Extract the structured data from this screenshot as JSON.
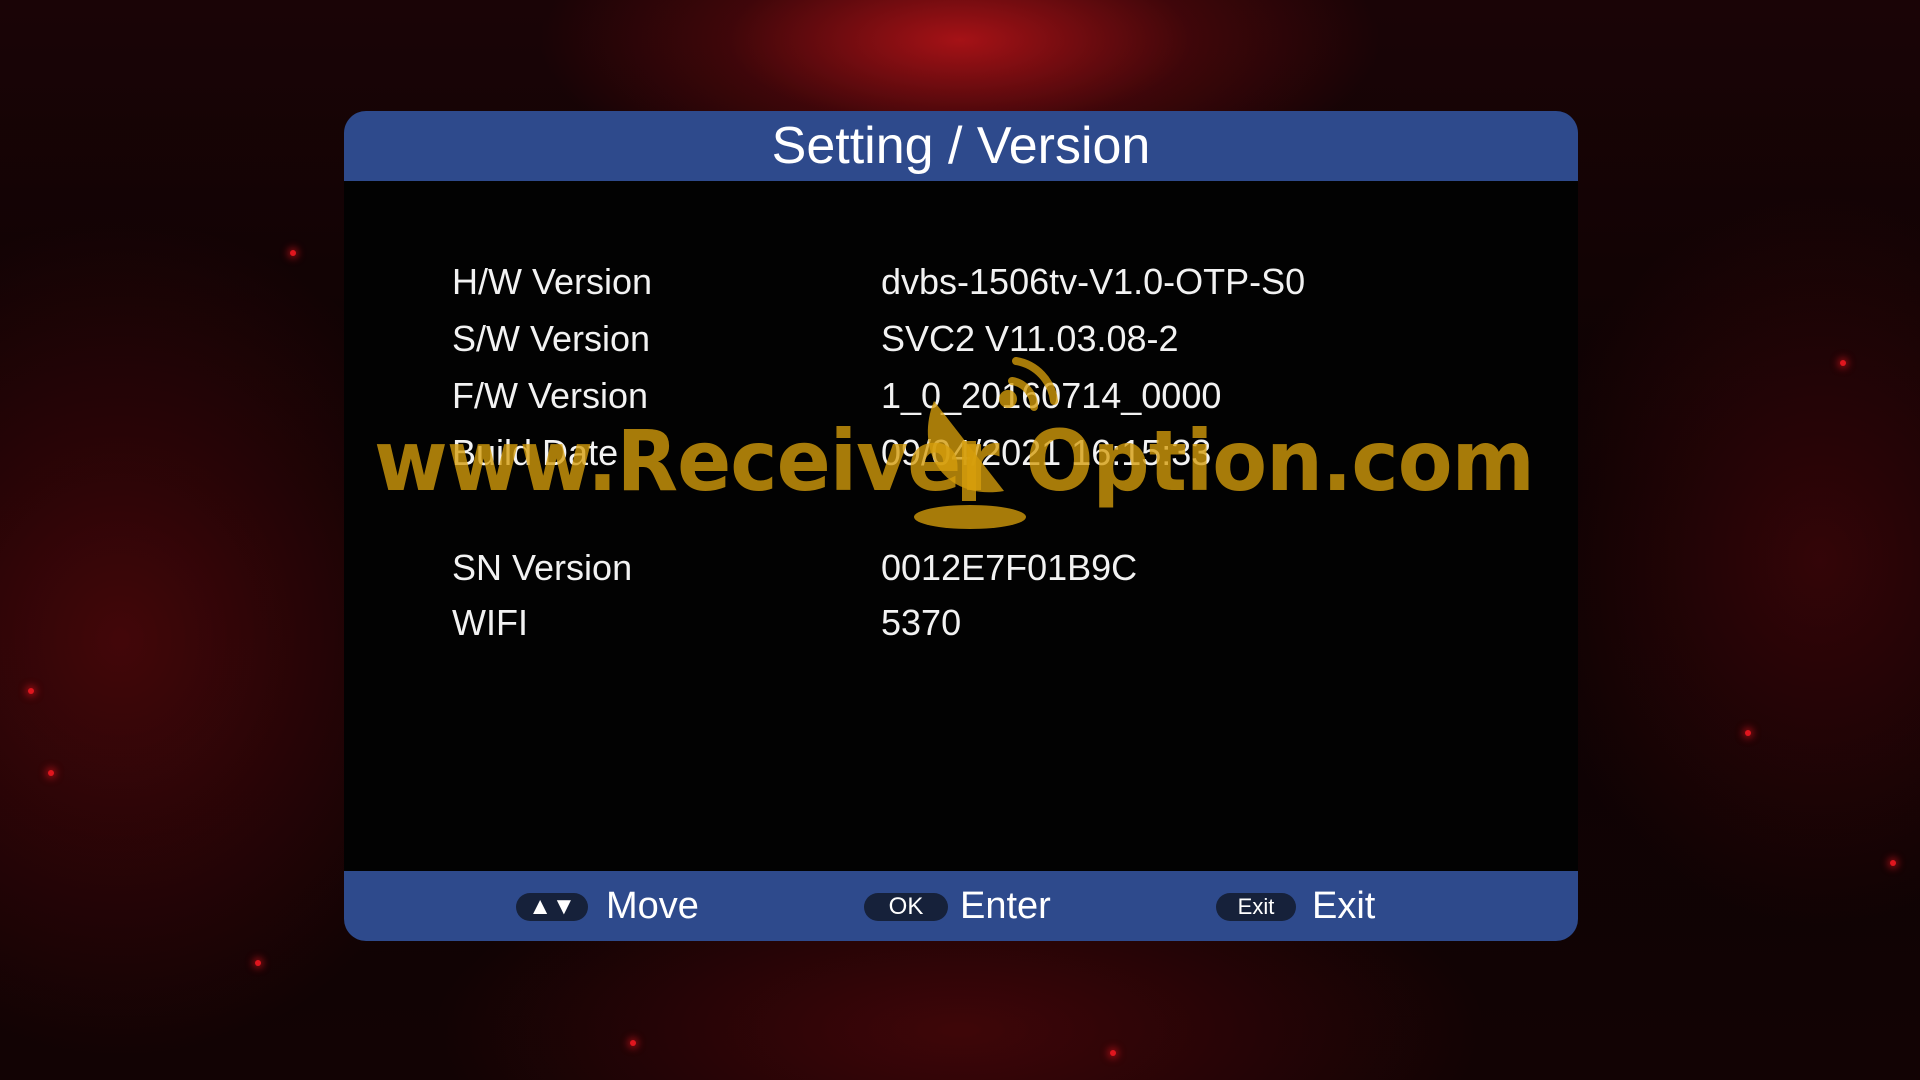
{
  "dialog": {
    "title": "Setting / Version"
  },
  "info_rows": [
    {
      "label": "H/W Version",
      "value": "dvbs-1506tv-V1.0-OTP-S0"
    },
    {
      "label": "S/W Version",
      "value": "SVC2 V11.03.08-2"
    },
    {
      "label": "F/W Version",
      "value": "1_0_20160714_0000"
    },
    {
      "label": "Build Date",
      "value": "09/04/2021 16:15:33"
    },
    {
      "label": "SN Version",
      "value": "0012E7F01B9C"
    },
    {
      "label": "WIFI",
      "value": "5370"
    }
  ],
  "watermark": {
    "text": "www.Receiver Option.com",
    "color": "#d69e0c"
  },
  "footer": {
    "hints": [
      {
        "key": "▲▼",
        "label": "Move",
        "icon": "up-down-arrows-icon"
      },
      {
        "key": "OK",
        "label": "Enter",
        "icon": "ok-key-icon"
      },
      {
        "key": "Exit",
        "label": "Exit",
        "icon": "exit-key-icon"
      }
    ]
  },
  "colors": {
    "bar_blue": "#2e4a8c",
    "panel_black": "#020202",
    "text_white": "#f2f2f2",
    "background_red": "#e0161e"
  }
}
